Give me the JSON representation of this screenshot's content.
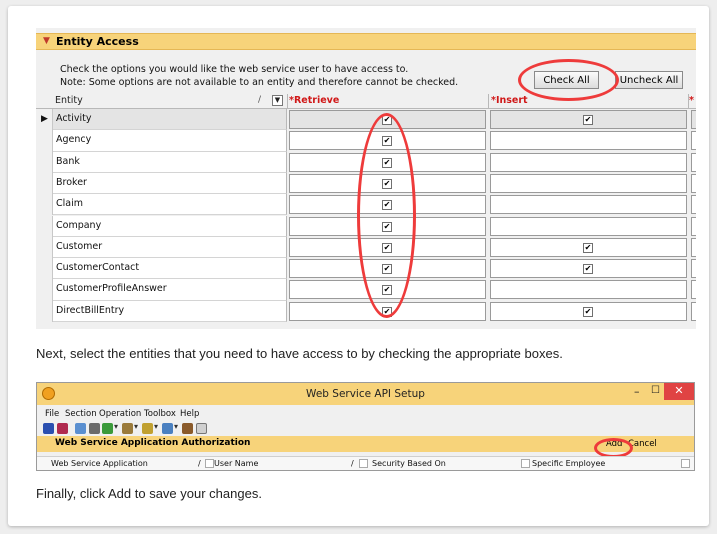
{
  "entity_access": {
    "title": "Entity Access",
    "description_line1": "Check the options you would like the web service user to have access to.",
    "description_line2": "Note:  Some options are not available to an entity and therefore cannot be checked.",
    "check_all_label": "Check All",
    "uncheck_all_label": "Uncheck All",
    "columns": {
      "entity": "Entity",
      "pin": "/",
      "dropdown": "▼",
      "retrieve": "*Retrieve",
      "insert": "*Insert",
      "more": "*"
    },
    "rows": [
      {
        "name": "Activity",
        "retrieve": true,
        "insert": true
      },
      {
        "name": "Agency",
        "retrieve": true,
        "insert": false
      },
      {
        "name": "Bank",
        "retrieve": true,
        "insert": false
      },
      {
        "name": "Broker",
        "retrieve": true,
        "insert": false
      },
      {
        "name": "Claim",
        "retrieve": true,
        "insert": false
      },
      {
        "name": "Company",
        "retrieve": true,
        "insert": false
      },
      {
        "name": "Customer",
        "retrieve": true,
        "insert": true
      },
      {
        "name": "CustomerContact",
        "retrieve": true,
        "insert": true
      },
      {
        "name": "CustomerProfileAnswer",
        "retrieve": true,
        "insert": false
      },
      {
        "name": "DirectBillEntry",
        "retrieve": true,
        "insert": true
      }
    ]
  },
  "captions": {
    "step1": "Next, select the entities that you need to have access to by checking the appropriate boxes.",
    "step2": "Finally, click Add to save your changes."
  },
  "api_setup": {
    "window_title": "Web Service API Setup",
    "minimize": "–",
    "maximize": "☐",
    "close": "✕",
    "menu": [
      "File",
      "Section",
      "Operation",
      "Toolbox",
      "Help"
    ],
    "section_title": "Web Service Application Authorization",
    "add_label": "Add",
    "cancel_label": "Cancel",
    "columns": [
      "Web Service Application",
      "User Name",
      "Security Based On",
      "Specific Employee"
    ]
  },
  "colors": {
    "accent_header": "#f7d37a",
    "highlight_ring": "#ee3b3b",
    "required_label": "#d01818"
  }
}
